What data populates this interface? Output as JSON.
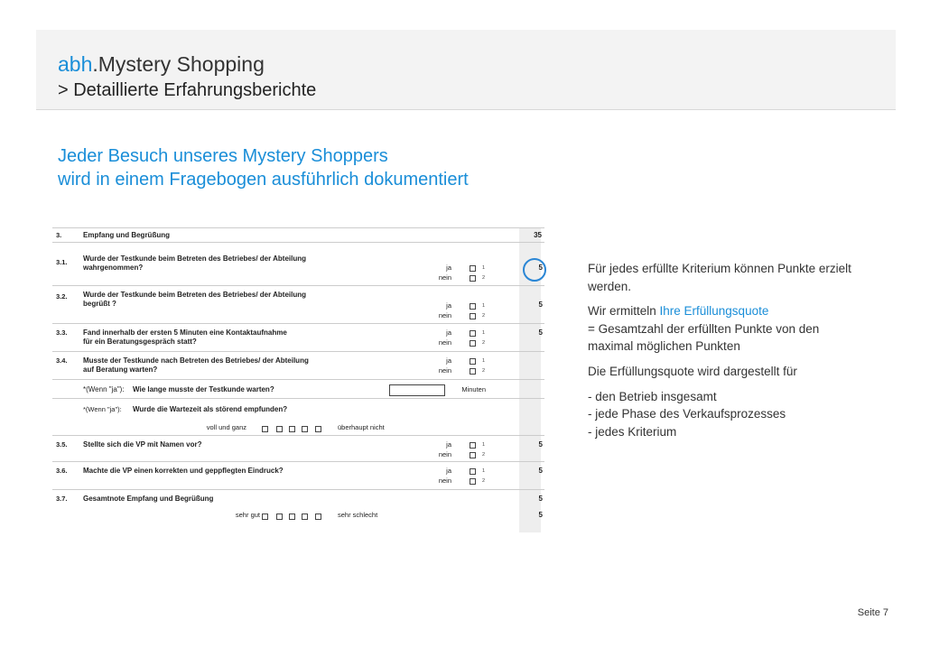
{
  "header": {
    "brand_prefix": "abh",
    "brand_rest": ".Mystery Shopping",
    "subtitle": "> Detaillierte Erfahrungsberichte"
  },
  "headline": {
    "line1": "Jeder Besuch unseres Mystery Shoppers",
    "line2": "wird in einem Fragebogen ausführlich dokumentiert"
  },
  "form": {
    "section_num": "3.",
    "section_title": "Empfang und Begrüßung",
    "section_points": "35",
    "yes_label": "ja",
    "no_label": "nein",
    "yes_code": "1",
    "no_code": "2",
    "questions": [
      {
        "num": "3.1.",
        "line1": "Wurde der Testkunde beim Betreten des Betriebes/ der Abteilung",
        "line2": "wahrgenommen?",
        "points": "5"
      },
      {
        "num": "3.2.",
        "line1": "Wurde der Testkunde beim Betreten des Betriebes/ der Abteilung",
        "line2": "begrüßt ?",
        "points": "5"
      },
      {
        "num": "3.3.",
        "line1": "Fand innerhalb der ersten 5 Minuten eine Kontaktaufnahme",
        "line2": "für ein Beratungsgespräch statt?",
        "points": "5"
      },
      {
        "num": "3.4.",
        "line1": "Musste der Testkunde nach Betreten des Betriebes/ der Abteilung",
        "line2": "auf Beratung warten?",
        "points": ""
      },
      {
        "num": "3.5.",
        "line1": "Stellte sich die VP mit Namen vor?",
        "line2": "",
        "points": "5"
      },
      {
        "num": "3.6.",
        "line1": "Machte die VP einen korrekten und geppflegten Eindruck?",
        "line2": "",
        "points": "5"
      }
    ],
    "wait_prefix": "*(Wenn \"ja\"):",
    "wait_question": "Wie lange musste der Testkunde warten?",
    "wait_unit": "Minuten",
    "disturb_prefix": "*(Wenn \"ja\"):",
    "disturb_question": "Wurde die Wartezeit als störend empfunden?",
    "scale1_left": "voll und ganz",
    "scale1_right": "überhaupt nicht",
    "overall_num": "3.7.",
    "overall_title": "Gesamtnote Empfang und Begrüßung",
    "overall_points": "5",
    "scale2_left": "sehr gut",
    "scale2_right": "sehr schlecht",
    "scale2_points": "5"
  },
  "side": {
    "p1": "Für jedes erfüllte Kriterium können Punkte erzielt werden.",
    "p2_a": "Wir ermitteln ",
    "p2_hl": "Ihre Erfüllungsquote",
    "p2_b": "= Gesamtzahl der erfüllten Punkte von den maximal möglichen Punkten",
    "p3": "Die Erfüllungsquote wird dargestellt für",
    "b1": "- den Betrieb insgesamt",
    "b2": "- jede Phase des Verkaufsprozesses",
    "b3": "- jedes Kriterium"
  },
  "footer": {
    "page": "Seite 7"
  },
  "colors": {
    "accent": "#1a8ed8"
  }
}
